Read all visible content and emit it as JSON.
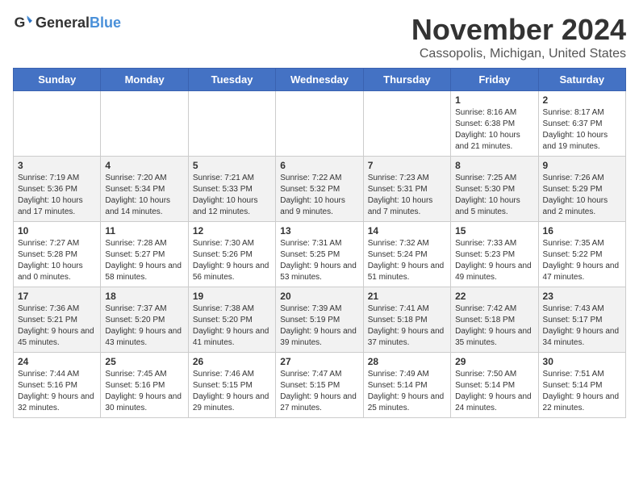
{
  "header": {
    "logo_general": "General",
    "logo_blue": "Blue",
    "title": "November 2024",
    "subtitle": "Cassopolis, Michigan, United States"
  },
  "calendar": {
    "days_of_week": [
      "Sunday",
      "Monday",
      "Tuesday",
      "Wednesday",
      "Thursday",
      "Friday",
      "Saturday"
    ],
    "weeks": [
      [
        {
          "day": "",
          "info": ""
        },
        {
          "day": "",
          "info": ""
        },
        {
          "day": "",
          "info": ""
        },
        {
          "day": "",
          "info": ""
        },
        {
          "day": "",
          "info": ""
        },
        {
          "day": "1",
          "info": "Sunrise: 8:16 AM\nSunset: 6:38 PM\nDaylight: 10 hours and 21 minutes."
        },
        {
          "day": "2",
          "info": "Sunrise: 8:17 AM\nSunset: 6:37 PM\nDaylight: 10 hours and 19 minutes."
        }
      ],
      [
        {
          "day": "3",
          "info": "Sunrise: 7:19 AM\nSunset: 5:36 PM\nDaylight: 10 hours and 17 minutes."
        },
        {
          "day": "4",
          "info": "Sunrise: 7:20 AM\nSunset: 5:34 PM\nDaylight: 10 hours and 14 minutes."
        },
        {
          "day": "5",
          "info": "Sunrise: 7:21 AM\nSunset: 5:33 PM\nDaylight: 10 hours and 12 minutes."
        },
        {
          "day": "6",
          "info": "Sunrise: 7:22 AM\nSunset: 5:32 PM\nDaylight: 10 hours and 9 minutes."
        },
        {
          "day": "7",
          "info": "Sunrise: 7:23 AM\nSunset: 5:31 PM\nDaylight: 10 hours and 7 minutes."
        },
        {
          "day": "8",
          "info": "Sunrise: 7:25 AM\nSunset: 5:30 PM\nDaylight: 10 hours and 5 minutes."
        },
        {
          "day": "9",
          "info": "Sunrise: 7:26 AM\nSunset: 5:29 PM\nDaylight: 10 hours and 2 minutes."
        }
      ],
      [
        {
          "day": "10",
          "info": "Sunrise: 7:27 AM\nSunset: 5:28 PM\nDaylight: 10 hours and 0 minutes."
        },
        {
          "day": "11",
          "info": "Sunrise: 7:28 AM\nSunset: 5:27 PM\nDaylight: 9 hours and 58 minutes."
        },
        {
          "day": "12",
          "info": "Sunrise: 7:30 AM\nSunset: 5:26 PM\nDaylight: 9 hours and 56 minutes."
        },
        {
          "day": "13",
          "info": "Sunrise: 7:31 AM\nSunset: 5:25 PM\nDaylight: 9 hours and 53 minutes."
        },
        {
          "day": "14",
          "info": "Sunrise: 7:32 AM\nSunset: 5:24 PM\nDaylight: 9 hours and 51 minutes."
        },
        {
          "day": "15",
          "info": "Sunrise: 7:33 AM\nSunset: 5:23 PM\nDaylight: 9 hours and 49 minutes."
        },
        {
          "day": "16",
          "info": "Sunrise: 7:35 AM\nSunset: 5:22 PM\nDaylight: 9 hours and 47 minutes."
        }
      ],
      [
        {
          "day": "17",
          "info": "Sunrise: 7:36 AM\nSunset: 5:21 PM\nDaylight: 9 hours and 45 minutes."
        },
        {
          "day": "18",
          "info": "Sunrise: 7:37 AM\nSunset: 5:20 PM\nDaylight: 9 hours and 43 minutes."
        },
        {
          "day": "19",
          "info": "Sunrise: 7:38 AM\nSunset: 5:20 PM\nDaylight: 9 hours and 41 minutes."
        },
        {
          "day": "20",
          "info": "Sunrise: 7:39 AM\nSunset: 5:19 PM\nDaylight: 9 hours and 39 minutes."
        },
        {
          "day": "21",
          "info": "Sunrise: 7:41 AM\nSunset: 5:18 PM\nDaylight: 9 hours and 37 minutes."
        },
        {
          "day": "22",
          "info": "Sunrise: 7:42 AM\nSunset: 5:18 PM\nDaylight: 9 hours and 35 minutes."
        },
        {
          "day": "23",
          "info": "Sunrise: 7:43 AM\nSunset: 5:17 PM\nDaylight: 9 hours and 34 minutes."
        }
      ],
      [
        {
          "day": "24",
          "info": "Sunrise: 7:44 AM\nSunset: 5:16 PM\nDaylight: 9 hours and 32 minutes."
        },
        {
          "day": "25",
          "info": "Sunrise: 7:45 AM\nSunset: 5:16 PM\nDaylight: 9 hours and 30 minutes."
        },
        {
          "day": "26",
          "info": "Sunrise: 7:46 AM\nSunset: 5:15 PM\nDaylight: 9 hours and 29 minutes."
        },
        {
          "day": "27",
          "info": "Sunrise: 7:47 AM\nSunset: 5:15 PM\nDaylight: 9 hours and 27 minutes."
        },
        {
          "day": "28",
          "info": "Sunrise: 7:49 AM\nSunset: 5:14 PM\nDaylight: 9 hours and 25 minutes."
        },
        {
          "day": "29",
          "info": "Sunrise: 7:50 AM\nSunset: 5:14 PM\nDaylight: 9 hours and 24 minutes."
        },
        {
          "day": "30",
          "info": "Sunrise: 7:51 AM\nSunset: 5:14 PM\nDaylight: 9 hours and 22 minutes."
        }
      ]
    ]
  }
}
